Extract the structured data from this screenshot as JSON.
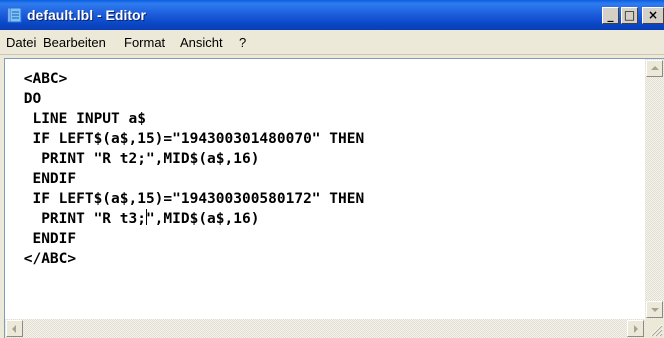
{
  "window": {
    "title": "default.lbl - Editor",
    "icon": "notepad-icon",
    "buttons": {
      "minimize": "_",
      "maximize": "□",
      "close": "×"
    }
  },
  "menubar": {
    "items": [
      "Datei",
      "Bearbeiten",
      "Format",
      "Ansicht",
      "?"
    ]
  },
  "editor": {
    "lines": [
      " <ABC>",
      " DO",
      "  LINE INPUT a$",
      "  IF LEFT$(a$,15)=\"194300301480070\" THEN",
      "   PRINT \"R t2;\",MID$(a$,16)",
      "  ENDIF",
      "  IF LEFT$(a$,15)=\"194300300580172\" THEN",
      "   PRINT \"R t3;",
      "\",MID$(a$,16)",
      "  ENDIF",
      " </ABC>"
    ]
  },
  "colors": {
    "titlebar": "#0b49c8",
    "window_face": "#ece9d8",
    "editor_bg": "#ffffff",
    "text": "#000000"
  }
}
